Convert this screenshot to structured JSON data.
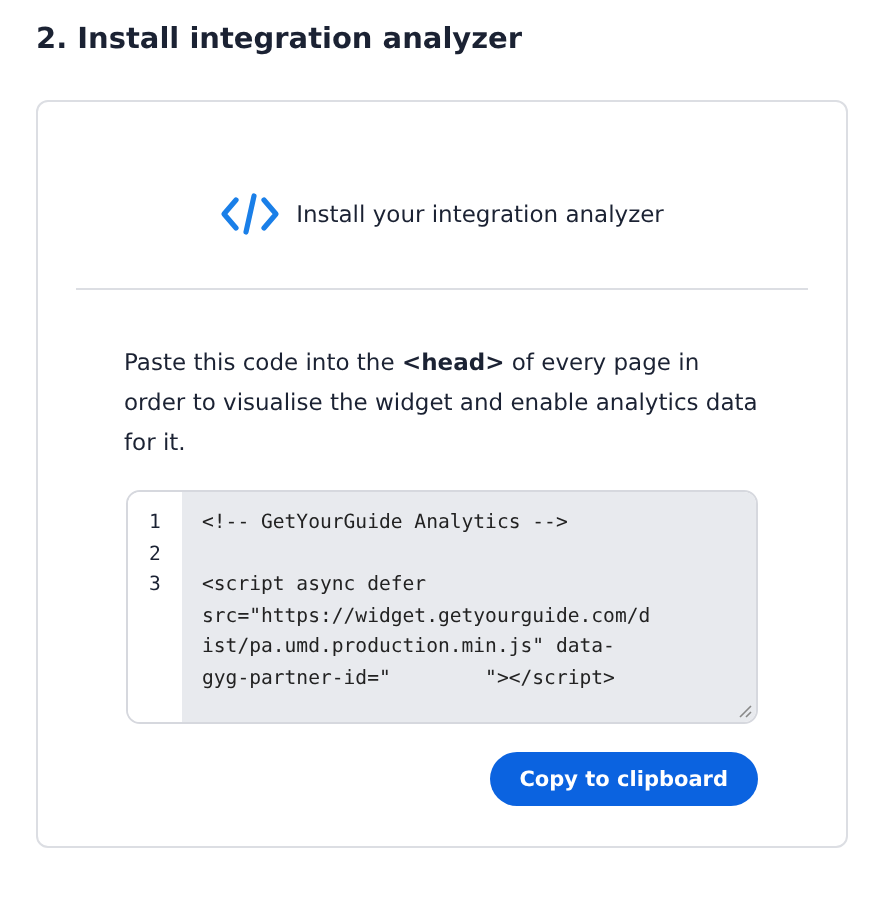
{
  "heading": "2. Install integration analyzer",
  "card": {
    "title": "Install your integration analyzer",
    "instructions": "Paste this code into the **<head>** of every page in order to visualise the widget and enable analytics data for it.",
    "code_lines": [
      {
        "number": "1",
        "text": "<!-- GetYourGuide Analytics -->"
      },
      {
        "number": "2"
      },
      {
        "number": "3",
        "text": "<script async defer src=\"https://widget.getyourguide.com/dist/pa.umd.production.min.js\" data-gyg-partner-id=\"        \"></script>"
      }
    ],
    "button": "Copy to clipboard"
  }
}
